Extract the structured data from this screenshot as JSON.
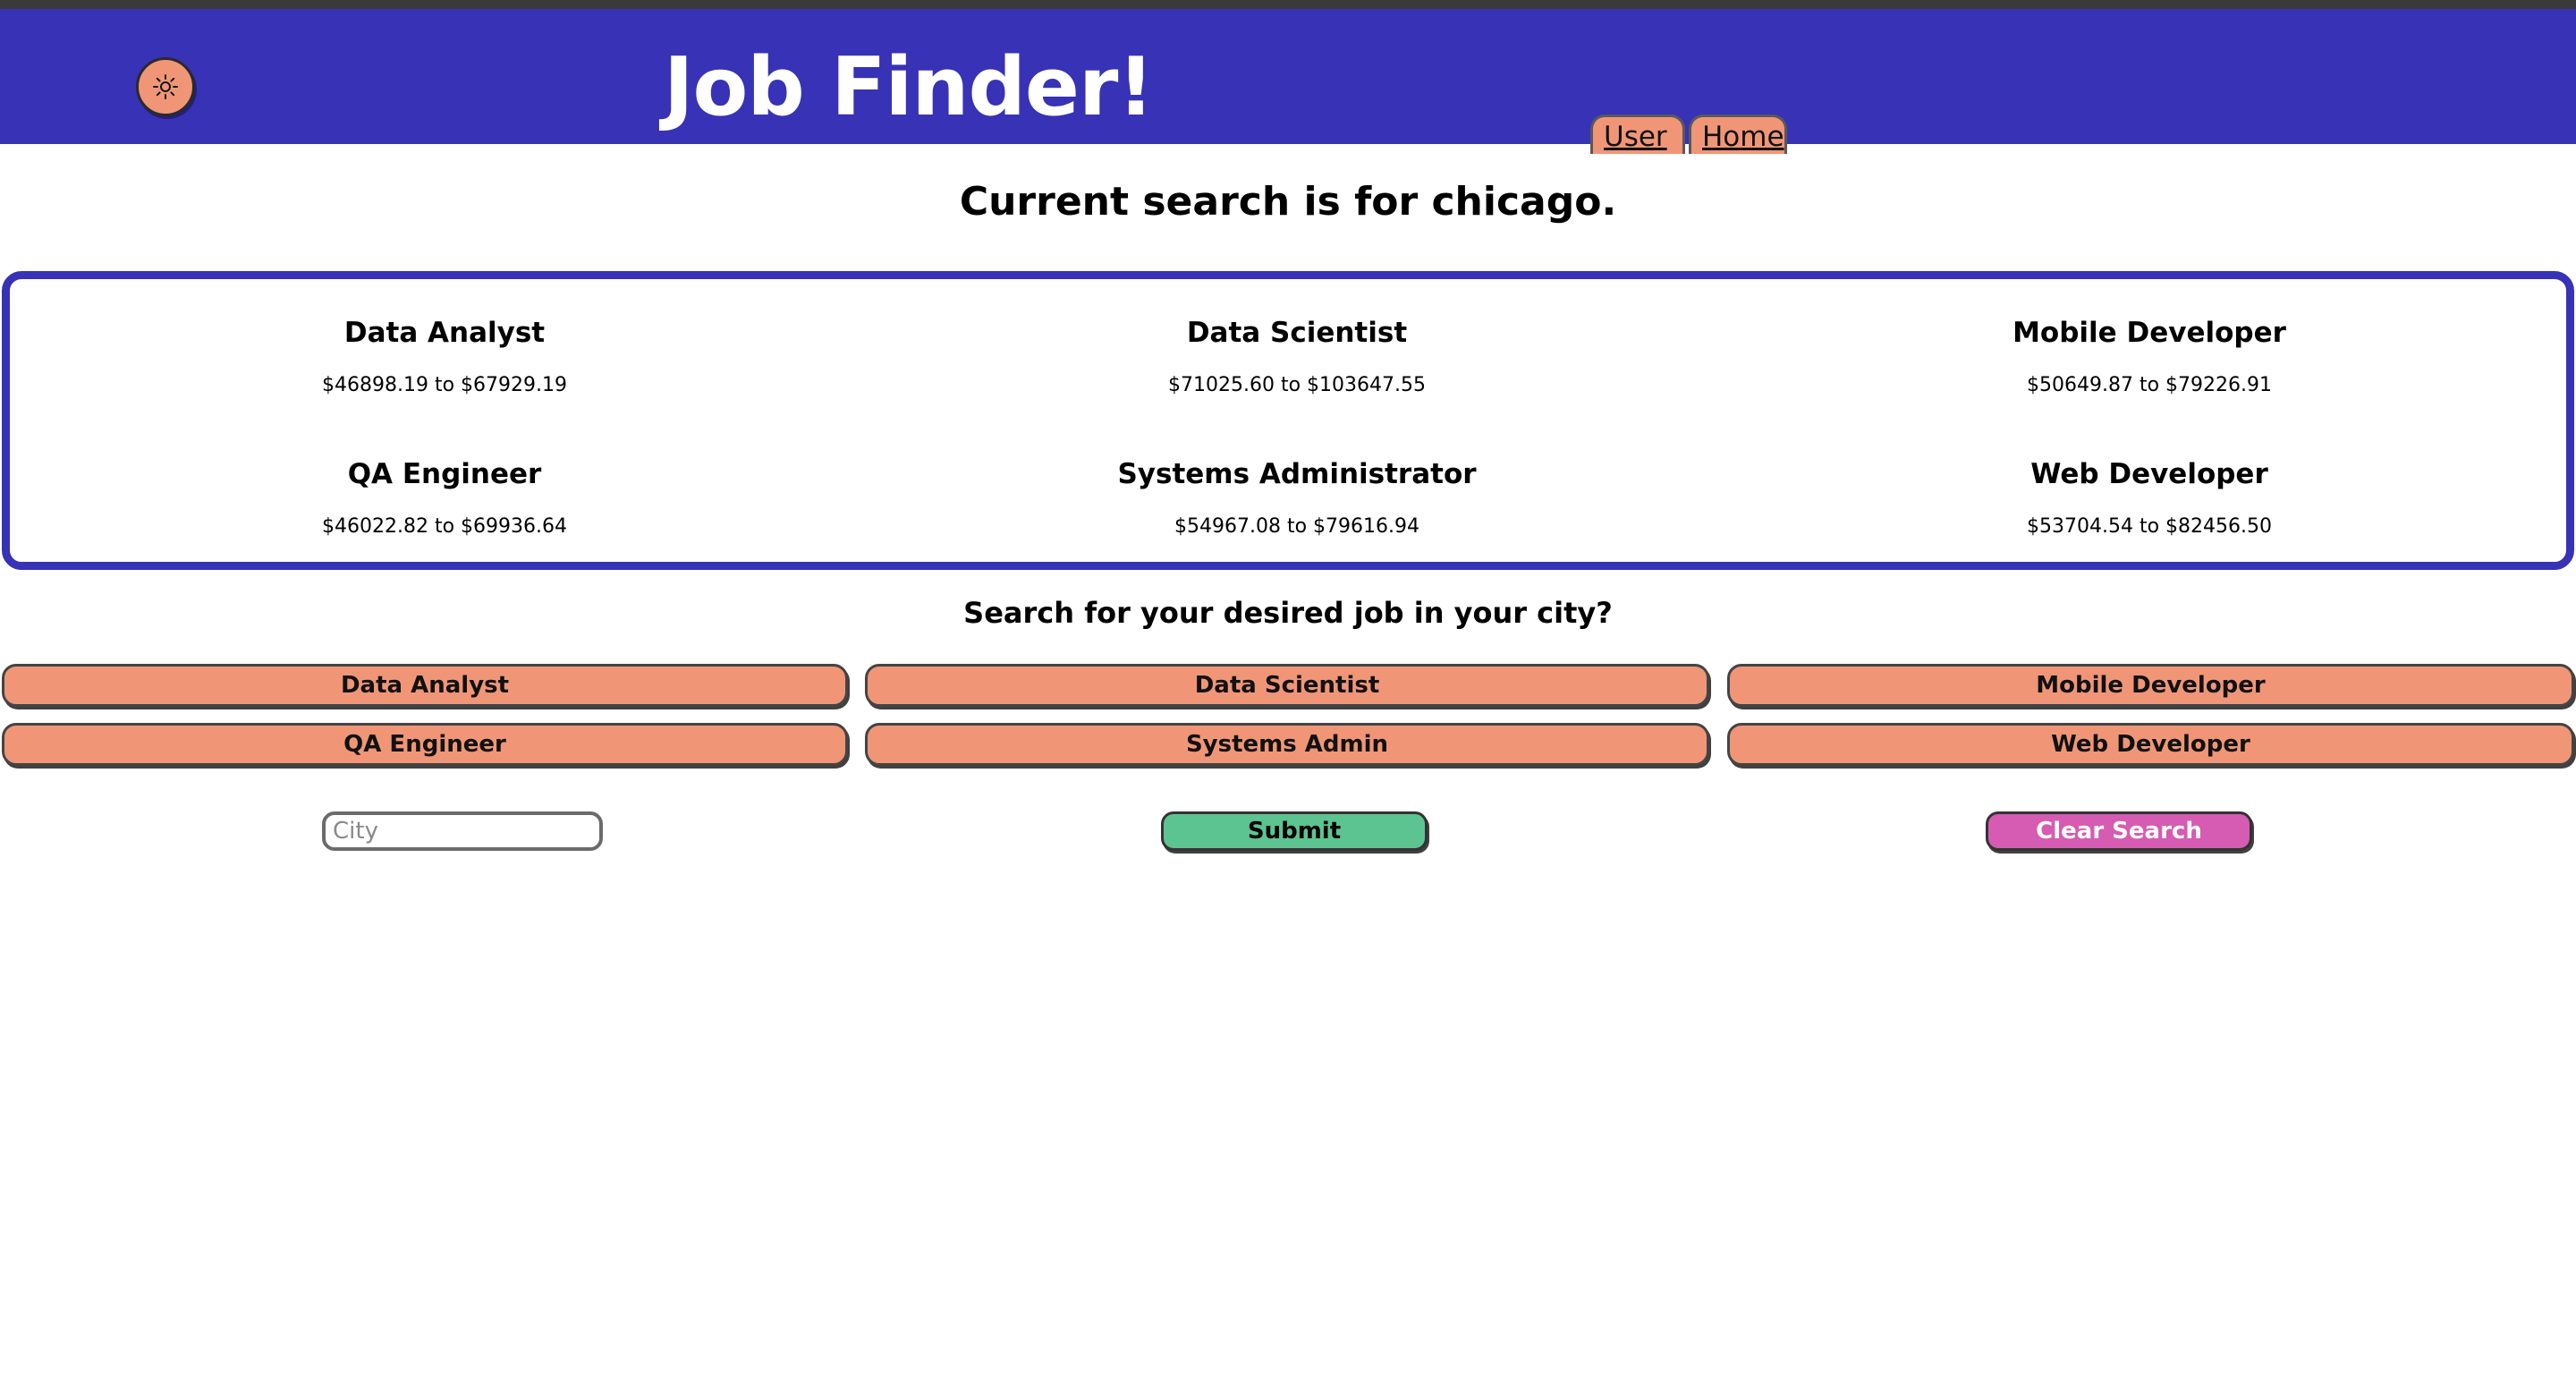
{
  "header": {
    "title": "Job Finder!",
    "theme_toggle_icon": "sun-icon",
    "nav": {
      "user_label": "User",
      "home_label": "Home"
    }
  },
  "search_heading": "Current search is for chicago.",
  "results": [
    {
      "title": "Data Analyst",
      "range": "$46898.19 to $67929.19"
    },
    {
      "title": "Data Scientist",
      "range": "$71025.60 to $103647.55"
    },
    {
      "title": "Mobile Developer",
      "range": "$50649.87 to $79226.91"
    },
    {
      "title": "QA Engineer",
      "range": "$46022.82 to $69936.64"
    },
    {
      "title": "Systems Administrator",
      "range": "$54967.08 to $79616.94"
    },
    {
      "title": "Web Developer",
      "range": "$53704.54 to $82456.50"
    }
  ],
  "prompt": "Search for your desired job in your city?",
  "job_buttons": [
    "Data Analyst",
    "Data Scientist",
    "Mobile Developer",
    "QA Engineer",
    "Systems Admin",
    "Web Developer"
  ],
  "form": {
    "city_placeholder": "City",
    "city_value": "",
    "submit_label": "Submit",
    "clear_label": "Clear Search"
  },
  "colors": {
    "header_bg": "#3732b6",
    "accent_orange": "#f09676",
    "submit_green": "#5cc491",
    "clear_pink": "#d65bb2"
  }
}
